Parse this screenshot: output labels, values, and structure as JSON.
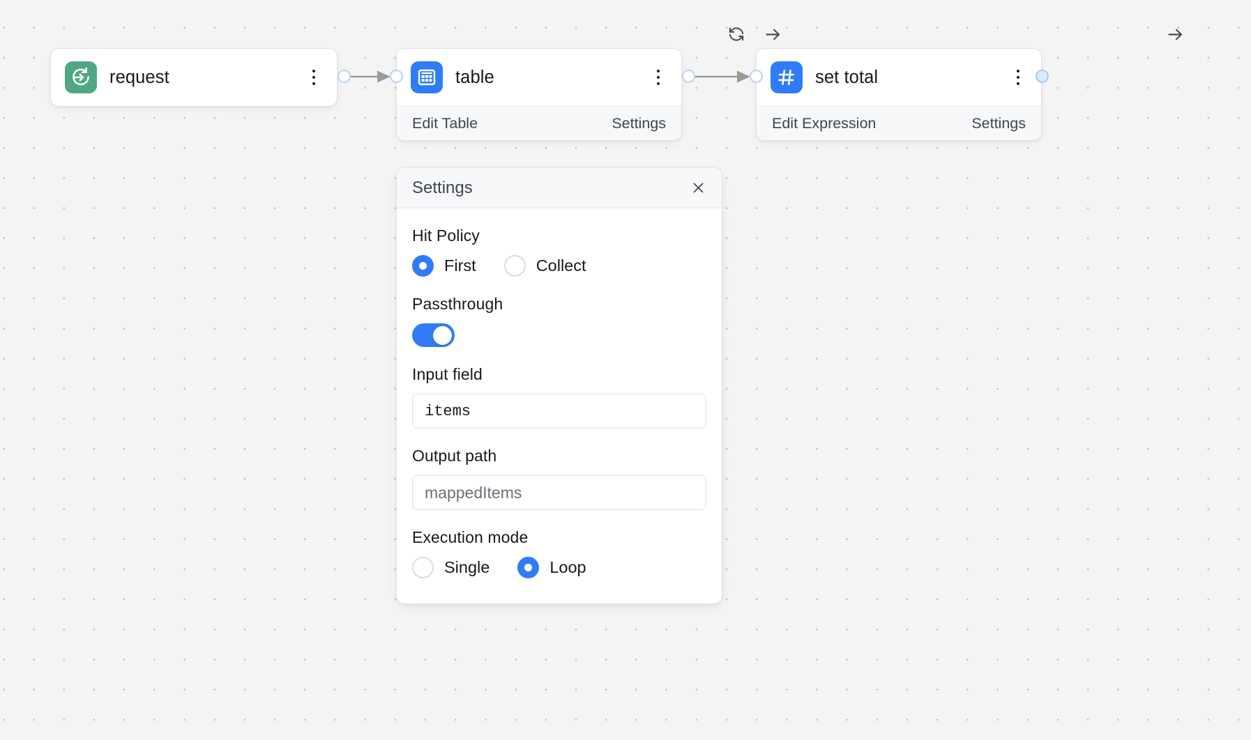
{
  "canvas": {
    "background_color": "#f4f4f4",
    "dot_color": "#b9b9b9"
  },
  "nodes": [
    {
      "id": "request",
      "title": "request",
      "icon": "request-arrow-icon",
      "icon_color": "#4fa882",
      "has_footer": false,
      "footer": {
        "primary": "",
        "secondary": ""
      }
    },
    {
      "id": "table",
      "title": "table",
      "icon": "table-grid-icon",
      "icon_color": "#2f7cf6",
      "has_footer": true,
      "footer": {
        "primary": "Edit Table",
        "secondary": "Settings"
      }
    },
    {
      "id": "set-total",
      "title": "set total",
      "icon": "hash-icon",
      "icon_color": "#2f7cf6",
      "has_footer": true,
      "footer": {
        "primary": "Edit Expression",
        "secondary": "Settings"
      }
    }
  ],
  "node_toolbar": {
    "table": [
      {
        "name": "refresh-icon",
        "label": "Refresh"
      },
      {
        "name": "run-arrow-icon",
        "label": "Run"
      }
    ],
    "set_total": [
      {
        "name": "run-arrow-icon",
        "label": "Run"
      }
    ]
  },
  "settings_panel": {
    "title": "Settings",
    "close_label": "Close",
    "fields": {
      "hit_policy": {
        "label": "Hit Policy",
        "options": [
          {
            "label": "First",
            "selected": true
          },
          {
            "label": "Collect",
            "selected": false
          }
        ]
      },
      "passthrough": {
        "label": "Passthrough",
        "enabled": true
      },
      "input_field": {
        "label": "Input field",
        "value": "items",
        "placeholder": ""
      },
      "output_path": {
        "label": "Output path",
        "value": "",
        "placeholder": "mappedItems"
      },
      "execution_mode": {
        "label": "Execution mode",
        "options": [
          {
            "label": "Single",
            "selected": false
          },
          {
            "label": "Loop",
            "selected": true
          }
        ]
      }
    }
  },
  "colors": {
    "accent": "#2f7cf6",
    "request_green": "#4fa882",
    "handle_border": "#b9d2f5",
    "edge": "#9a9a9a"
  }
}
